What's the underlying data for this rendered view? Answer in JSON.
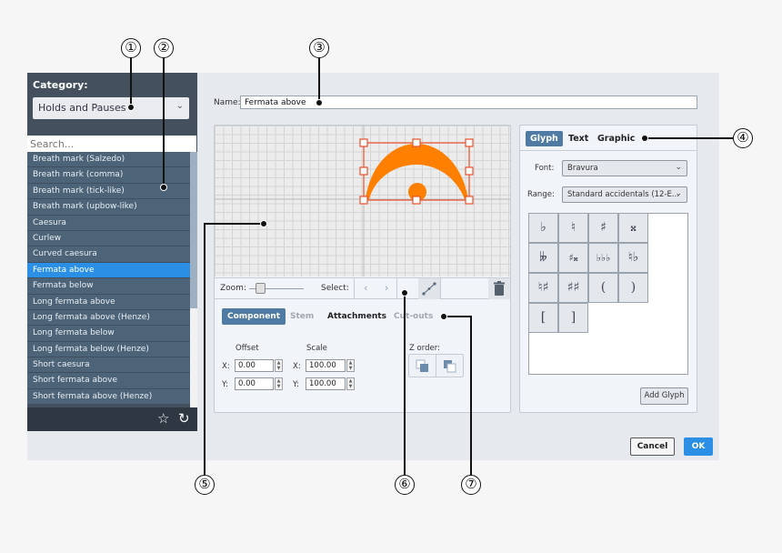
{
  "category": {
    "label": "Category:",
    "selected": "Holds and Pauses",
    "search_placeholder": "Search..."
  },
  "list": {
    "items": [
      {
        "label": "Breath mark (Salzedo)"
      },
      {
        "label": "Breath mark (comma)"
      },
      {
        "label": "Breath mark (tick-like)"
      },
      {
        "label": "Breath mark (upbow-like)"
      },
      {
        "label": "Caesura"
      },
      {
        "label": "Curlew"
      },
      {
        "label": "Curved caesura"
      },
      {
        "label": "Fermata above",
        "selected": true
      },
      {
        "label": "Fermata below"
      },
      {
        "label": "Long fermata above"
      },
      {
        "label": "Long fermata above (Henze)"
      },
      {
        "label": "Long fermata below"
      },
      {
        "label": "Long fermata below (Henze)"
      },
      {
        "label": "Short caesura"
      },
      {
        "label": "Short fermata above"
      },
      {
        "label": "Short fermata above (Henze)"
      }
    ],
    "footer_icons": [
      "star-icon",
      "reset-icon"
    ]
  },
  "name": {
    "label": "Name:",
    "value": "Fermata above"
  },
  "canvas": {
    "glyph_color": "#ff7f00",
    "selection_color": "#e8502a"
  },
  "toolbar": {
    "zoom_label": "Zoom:",
    "zoom_level": 0.2,
    "select_label": "Select:",
    "prev": "‹",
    "next": "›"
  },
  "component_tabs": [
    {
      "label": "Component",
      "state": "active"
    },
    {
      "label": "Stem",
      "state": "disabled"
    },
    {
      "label": "Attachments",
      "state": "normal"
    },
    {
      "label": "Cut-outs",
      "state": "disabled"
    }
  ],
  "properties": {
    "offset_label": "Offset",
    "scale_label": "Scale",
    "x_label": "X:",
    "y_label": "Y:",
    "offset_x": "0.00",
    "offset_y": "0.00",
    "scale_x": "100.00",
    "scale_y": "100.00",
    "z_order_label": "Z order:"
  },
  "right_tabs": [
    {
      "label": "Glyph",
      "state": "active"
    },
    {
      "label": "Text",
      "state": "normal"
    },
    {
      "label": "Graphic",
      "state": "normal"
    }
  ],
  "glyph_panel": {
    "font_label": "Font:",
    "font_value": "Bravura",
    "range_label": "Range:",
    "range_value": "Standard accidentals (12-E...",
    "glyphs": [
      "♭",
      "♮",
      "♯",
      "𝄪",
      "𝄫",
      "♯𝄪",
      "♭♭♭",
      "♮♭",
      "♮♯",
      "♯♯",
      "(",
      ")",
      "[",
      "]"
    ],
    "add_glyph_label": "Add Glyph"
  },
  "buttons": {
    "cancel": "Cancel",
    "ok": "OK"
  },
  "callouts": [
    "①",
    "②",
    "③",
    "④",
    "⑤",
    "⑥",
    "⑦"
  ]
}
